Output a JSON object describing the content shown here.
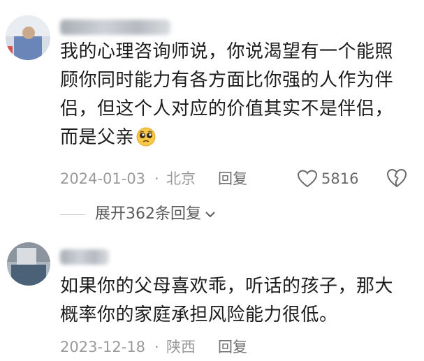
{
  "comments": [
    {
      "text": "我的心理咨询师说，你说渴望有一个能照顾你同时能力有各方面比你强的人作为伴侣，但这个人对应的价值其实不是伴侣，而是父亲",
      "date": "2024-01-03",
      "location": "北京",
      "reply_label": "回复",
      "likes": "5816",
      "expand_label": "展开362条回复",
      "emoji": "pleading-face-emoji"
    },
    {
      "text": "如果你的父母喜欢乖，听话的孩子，那大概率你的家庭承担风险能力很低。",
      "date": "2023-12-18",
      "location": "陕西",
      "reply_label": "回复"
    }
  ],
  "separator": "·",
  "colors": {
    "text": "#1c1c1c",
    "meta": "#9a9a9a",
    "background": "#ffffff"
  }
}
